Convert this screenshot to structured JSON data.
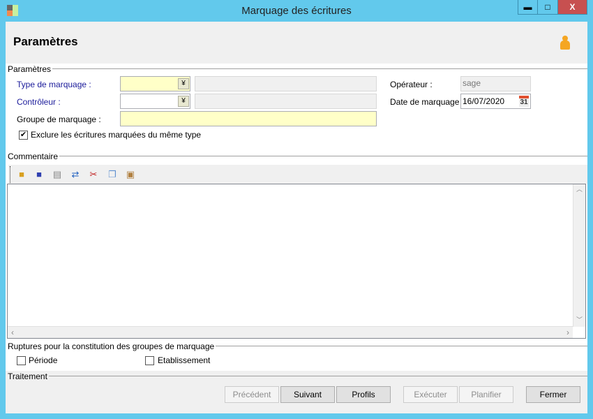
{
  "window": {
    "title": "Marquage des écritures",
    "minimize": "▬",
    "maximize": "□",
    "close": "X"
  },
  "header": {
    "title": "Paramètres",
    "user_icon": "person-icon"
  },
  "parametres": {
    "section": "Paramètres",
    "type_label": "Type de marquage :",
    "type_value": "",
    "type_desc": "",
    "controleur_label": "Contrôleur :",
    "controleur_value": "",
    "controleur_desc": "",
    "groupe_label": "Groupe de marquage :",
    "groupe_value": "",
    "operateur_label": "Opérateur :",
    "operateur_value": "sage",
    "date_label": "Date de marquage :",
    "date_value": "16/07/2020",
    "calendar_text": "31",
    "exclure_label": "Exclure les écritures marquées du même type",
    "exclure_checked": true
  },
  "commentaire": {
    "section": "Commentaire",
    "text": "",
    "toolbar": [
      "open-icon",
      "save-icon",
      "print-icon",
      "refresh-icon",
      "cut-icon",
      "copy-icon",
      "paste-icon"
    ]
  },
  "ruptures": {
    "section": "Ruptures pour la constitution des groupes de marquage",
    "periode": "Période",
    "periode_checked": false,
    "etablissement": "Etablissement",
    "etablissement_checked": false
  },
  "traitement": {
    "section": "Traitement",
    "buttons": {
      "precedent": "Précédent",
      "suivant": "Suivant",
      "profils": "Profils",
      "executer": "Exécuter",
      "planifier": "Planifier",
      "fermer": "Fermer"
    }
  }
}
